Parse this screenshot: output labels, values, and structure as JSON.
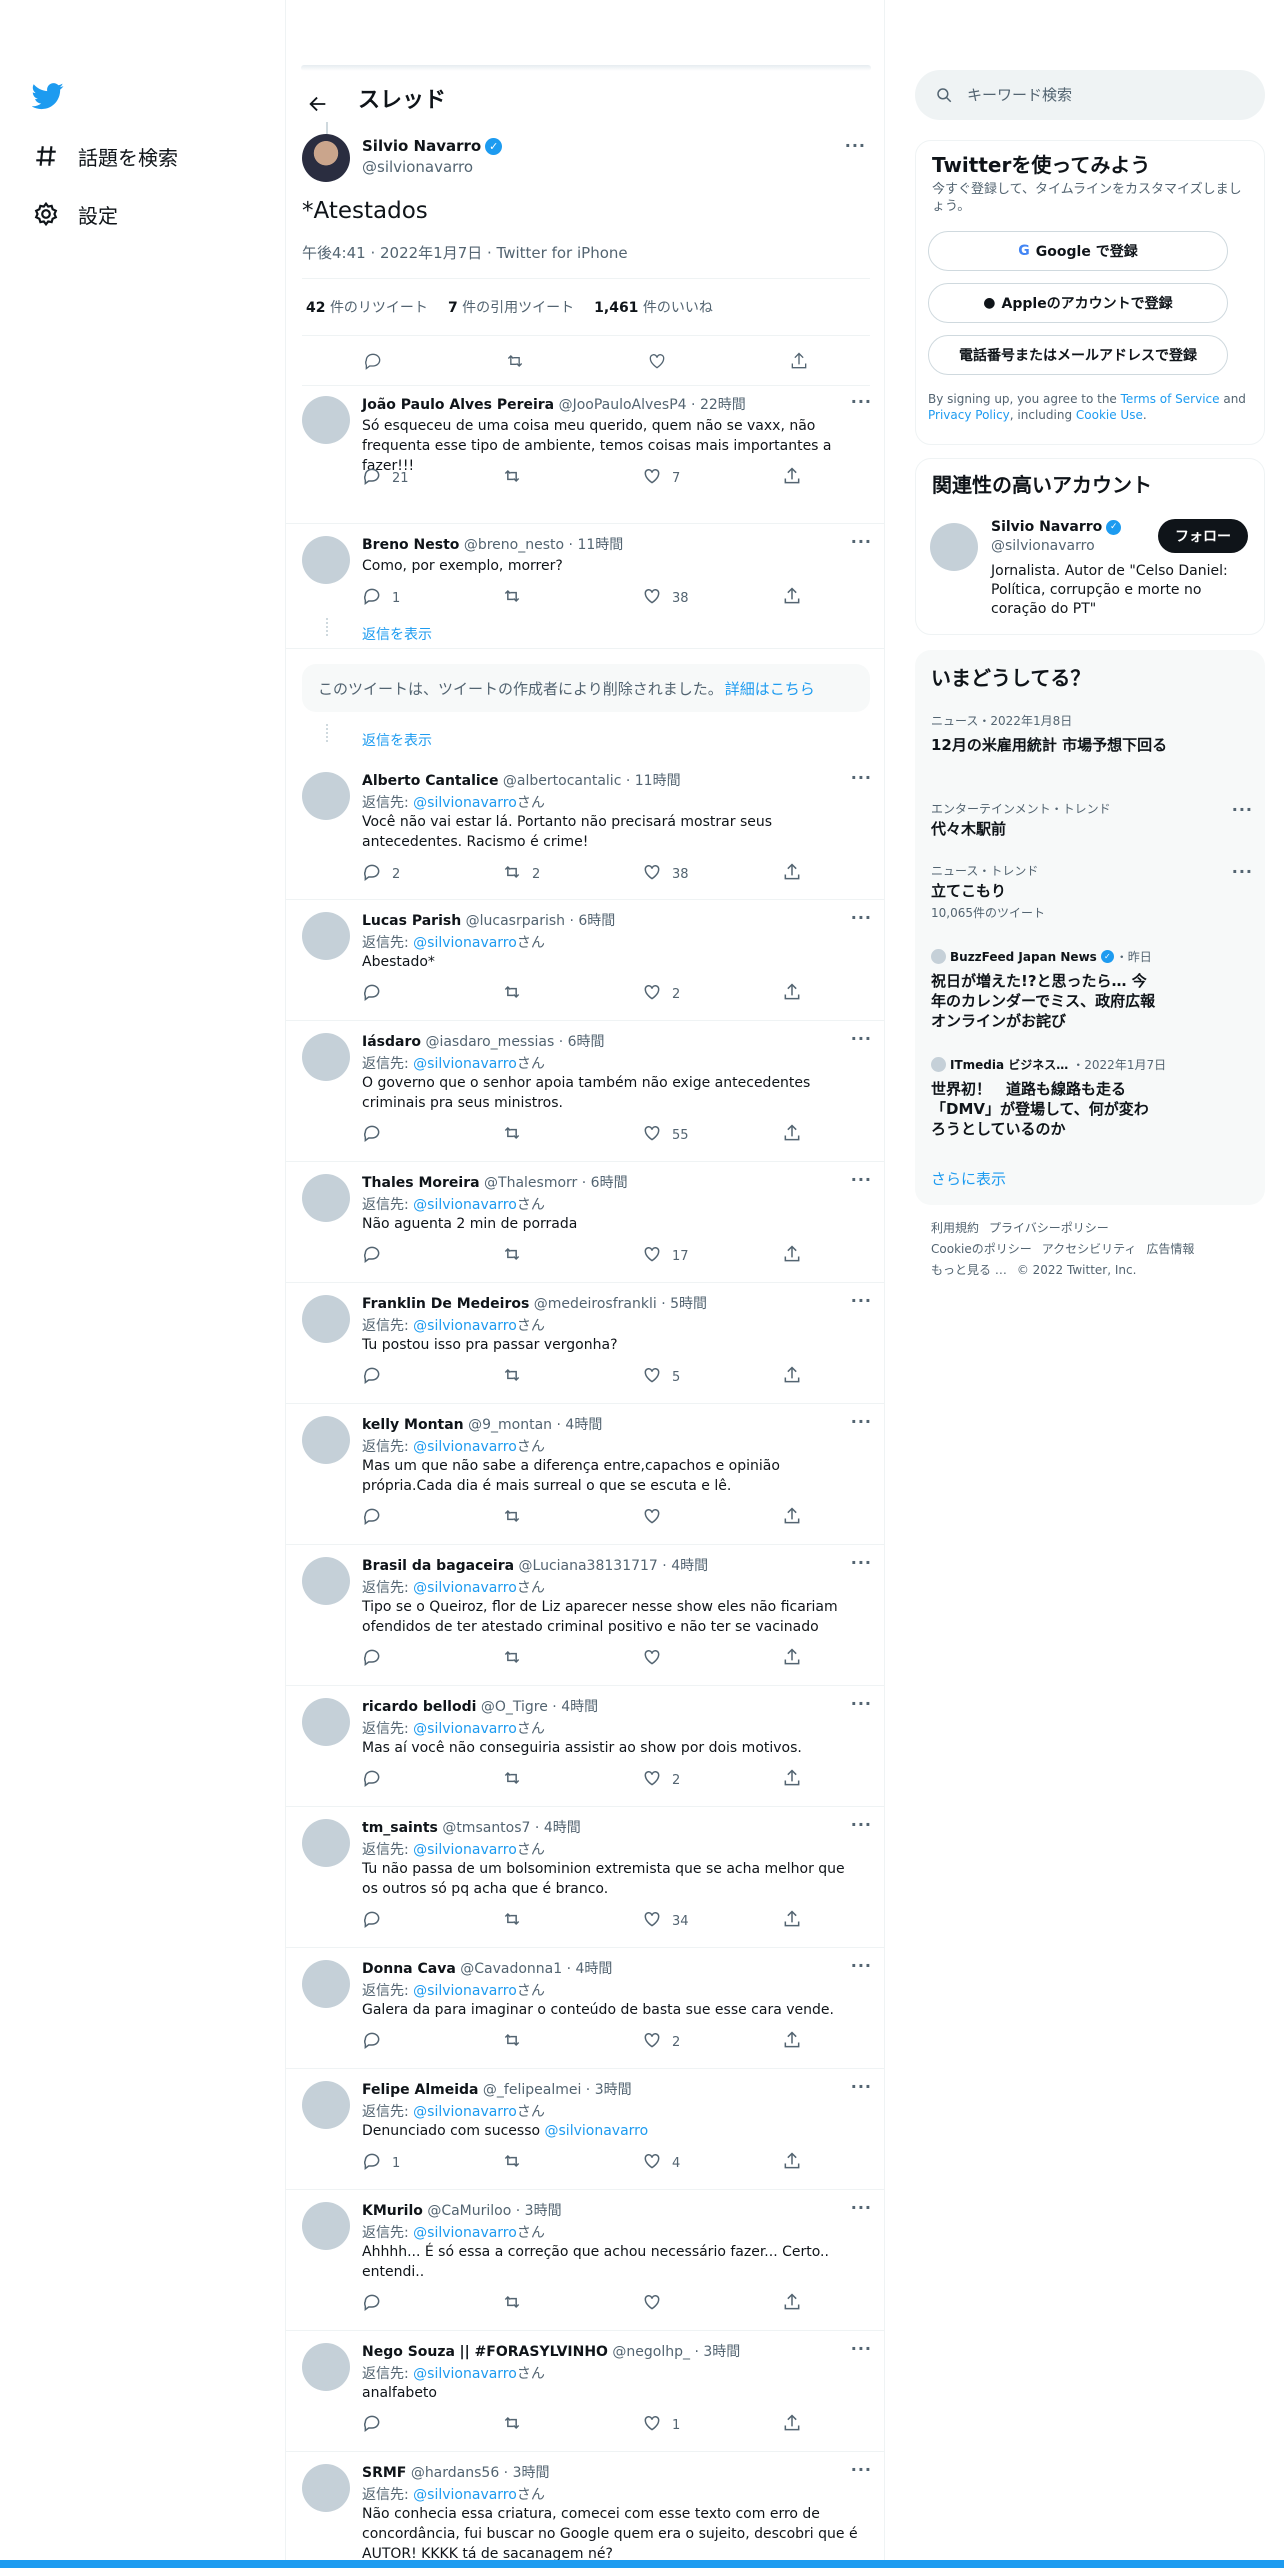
{
  "nav": {
    "explore": "話題を検索",
    "settings": "設定"
  },
  "header": {
    "title": "スレッド"
  },
  "main_tweet": {
    "name": "Silvio Navarro",
    "handle": "@silvionavarro",
    "text": "*Atestados",
    "meta": "午後4:41 · 2022年1月7日 · Twitter for iPhone",
    "retweets": "42",
    "retweets_label": "件のリツイート",
    "quotes": "7",
    "quotes_label": "件の引用ツイート",
    "likes": "1,461",
    "likes_label": "件のいいね"
  },
  "show_replies": "返信を表示",
  "deleted_notice": {
    "text": "このツイートは、ツイートの作成者により削除されました。",
    "link": "詳細はこちら"
  },
  "replying_to_label": "返信先: ",
  "replying_to_handle": "@silvionavarro",
  "replying_to_suffix": "さん",
  "replies": [
    {
      "name": "João Paulo Alves Pereira",
      "handle": "@JooPauloAlvesP4",
      "time": "22時間",
      "reply_to": false,
      "text": "Só esqueceu de uma coisa meu querido, quem não se vaxx, não frequenta esse tipo de ambiente, temos coisas mais importantes a fazer!!!",
      "replies": "21",
      "retweets": "",
      "likes": "7"
    },
    {
      "name": "Breno Nesto",
      "handle": "@breno_nesto",
      "time": "11時間",
      "reply_to": false,
      "text": "Como, por exemplo, morrer?",
      "replies": "1",
      "retweets": "",
      "likes": "38"
    },
    {
      "name": "Alberto Cantalice",
      "handle": "@albertocantalic",
      "time": "11時間",
      "reply_to": true,
      "text": "Você não vai estar lá. Portanto não precisará mostrar seus antecedentes. Racismo é crime!",
      "replies": "2",
      "retweets": "2",
      "likes": "38"
    },
    {
      "name": "Lucas Parish",
      "handle": "@lucasrparish",
      "time": "6時間",
      "reply_to": true,
      "text": "Abestado*",
      "replies": "",
      "retweets": "",
      "likes": "2"
    },
    {
      "name": "Iásdaro",
      "handle": "@iasdaro_messias",
      "time": "6時間",
      "reply_to": true,
      "text": "O governo que o senhor apoia também não exige antecedentes criminais pra seus ministros.",
      "replies": "",
      "retweets": "",
      "likes": "55"
    },
    {
      "name": "Thales Moreira",
      "handle": "@Thalesmorr",
      "time": "6時間",
      "reply_to": true,
      "text": "Não aguenta 2 min de porrada",
      "replies": "",
      "retweets": "",
      "likes": "17"
    },
    {
      "name": "Franklin De Medeiros",
      "handle": "@medeirosfrankli",
      "time": "5時間",
      "reply_to": true,
      "text": "Tu postou isso pra passar vergonha?",
      "replies": "",
      "retweets": "",
      "likes": "5"
    },
    {
      "name": "kelly Montan",
      "handle": "@9_montan",
      "time": "4時間",
      "reply_to": true,
      "text": "Mas um que não sabe a diferença entre,capachos e opinião própria.Cada dia é mais surreal o que se escuta e lê.",
      "replies": "",
      "retweets": "",
      "likes": ""
    },
    {
      "name": "Brasil da bagaceira",
      "handle": "@Luciana38131717",
      "time": "4時間",
      "reply_to": true,
      "text": "Tipo se o Queiroz, flor de Liz  aparecer nesse show eles não ficariam ofendidos de ter atestado criminal positivo e não ter se vacinado",
      "replies": "",
      "retweets": "",
      "likes": ""
    },
    {
      "name": "ricardo bellodi",
      "handle": "@O_Tigre",
      "time": "4時間",
      "reply_to": true,
      "text": "Mas aí você não conseguiria assistir ao show por dois motivos.",
      "replies": "",
      "retweets": "",
      "likes": "2"
    },
    {
      "name": "tm_saints",
      "handle": "@tmsantos7",
      "time": "4時間",
      "reply_to": true,
      "text": "Tu não passa de um bolsominion extremista que se acha melhor que os outros só pq acha que é branco.",
      "replies": "",
      "retweets": "",
      "likes": "34"
    },
    {
      "name": "Donna Cava",
      "handle": "@Cavadonna1",
      "time": "4時間",
      "reply_to": true,
      "text": "Galera da para imaginar o conteúdo de basta sue esse cara vende.",
      "replies": "",
      "retweets": "",
      "likes": "2"
    },
    {
      "name": "Felipe Almeida",
      "handle": "@_felipealmei",
      "time": "3時間",
      "reply_to": true,
      "text": "Denunciado com sucesso ",
      "mention": "@silvionavarro",
      "replies": "1",
      "retweets": "",
      "likes": "4"
    },
    {
      "name": "KMurilo",
      "handle": "@CaMuriloo",
      "time": "3時間",
      "reply_to": true,
      "text": "Ahhhh... É só essa a correção que achou necessário fazer... Certo.. entendi..",
      "replies": "",
      "retweets": "",
      "likes": ""
    },
    {
      "name": "Nego Souza",
      "handle": "@negolhp_",
      "time": "3時間",
      "reply_to": true,
      "name_extra": "|| #FORASYLVINHO",
      "text": "analfabeto",
      "replies": "",
      "retweets": "",
      "likes": "1"
    },
    {
      "name": "SRMF",
      "handle": "@hardans56",
      "time": "3時間",
      "reply_to": true,
      "text": "Não conhecia essa criatura, comecei com esse texto com erro de concordância, fui buscar no Google quem era o sujeito, descobri que é AUTOR! KKKK tá de sacanagem né?",
      "replies": "",
      "retweets": "",
      "likes": ""
    }
  ],
  "search": {
    "placeholder": "キーワード検索"
  },
  "signup": {
    "title": "Twitterを使ってみよう",
    "subtitle": "今すぐ登録して、タイムラインをカスタマイズしましょう。",
    "google": "Google で登録",
    "apple": "Appleのアカウントで登録",
    "phone": "電話番号またはメールアドレスで登録",
    "terms_1": "By signing up, you agree to the ",
    "terms_link1": "Terms of Service",
    "terms_2": " and ",
    "terms_link2": "Privacy Policy",
    "terms_3": ", including ",
    "terms_link3": "Cookie Use",
    "terms_4": "."
  },
  "relevant": {
    "title": "関連性の高いアカウント",
    "name": "Silvio Navarro",
    "handle": "@silvionavarro",
    "bio": "Jornalista. Autor de \"Celso Daniel: Política, corrupção e morte no coração do PT\"",
    "follow": "フォロー"
  },
  "trends": {
    "title": "いまどうしてる？",
    "items": [
      {
        "cat": "ニュース・2022年1月8日",
        "title": "12月の米雇用統計 市場予想下回る"
      },
      {
        "cat": "エンターテインメント・トレンド",
        "title": "代々木駅前"
      },
      {
        "cat": "ニュース・トレンド",
        "title": "立てこもり",
        "sub": "10,065件のツイート"
      },
      {
        "src": "BuzzFeed Japan News",
        "time": "・昨日",
        "title": "祝日が増えた!?と思ったら… 今年のカレンダーでミス、政府広報オンラインがお詫び"
      },
      {
        "src": "ITmedia ビジネス…",
        "time": "・2022年1月7日",
        "title": "世界初！　道路も線路も走る「DMV」が登場して、何が変わろうとしているのか"
      }
    ],
    "show_more": "さらに表示"
  },
  "footer": {
    "links1": [
      "利用規約",
      "プライバシーポリシー"
    ],
    "links2": [
      "Cookieのポリシー",
      "アクセシビリティ",
      "広告情報"
    ],
    "more": "もっと見る …",
    "copyright": "© 2022 Twitter, Inc."
  },
  "colors": {
    "accent": "#1d9bf0",
    "text": "#0f1419",
    "muted": "#536471"
  }
}
